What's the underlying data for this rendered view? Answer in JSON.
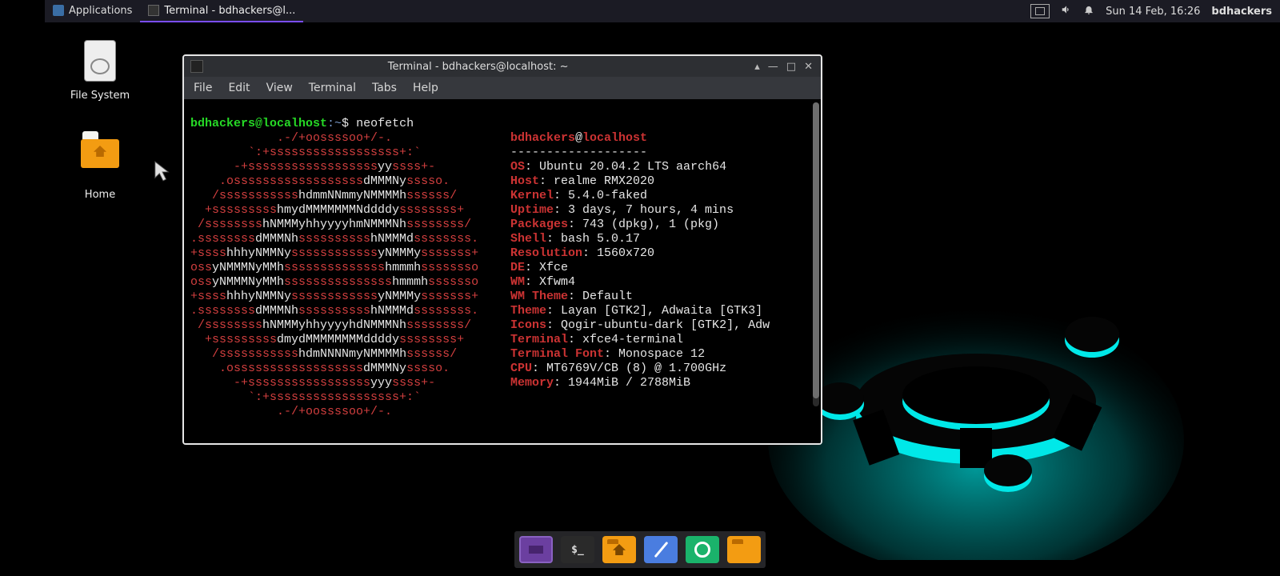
{
  "topbar": {
    "applications_label": "Applications",
    "task_title": "Terminal - bdhackers@l...",
    "clock": "Sun 14 Feb, 16:26",
    "user": "bdhackers"
  },
  "desktop": {
    "file_system_label": "File System",
    "home_label": "Home"
  },
  "window": {
    "title": "Terminal - bdhackers@localhost: ~",
    "menu": {
      "file": "File",
      "edit": "Edit",
      "view": "View",
      "terminal": "Terminal",
      "tabs": "Tabs",
      "help": "Help"
    }
  },
  "prompt": {
    "user_host": "bdhackers@localhost",
    "cwd": ":~",
    "sigil": "$",
    "command": "neofetch"
  },
  "neofetch": {
    "header_user": "bdhackers",
    "header_at": "@",
    "header_host": "localhost",
    "sep": "-------------------",
    "os_k": "OS",
    "os_v": "Ubuntu 20.04.2 LTS aarch64",
    "host_k": "Host",
    "host_v": "realme RMX2020",
    "kernel_k": "Kernel",
    "kernel_v": "5.4.0-faked",
    "uptime_k": "Uptime",
    "uptime_v": "3 days, 7 hours, 4 mins",
    "packages_k": "Packages",
    "packages_v": "743 (dpkg), 1 (pkg)",
    "shell_k": "Shell",
    "shell_v": "bash 5.0.17",
    "resolution_k": "Resolution",
    "resolution_v": "1560x720",
    "de_k": "DE",
    "de_v": "Xfce",
    "wm_k": "WM",
    "wm_v": "Xfwm4",
    "wmtheme_k": "WM Theme",
    "wmtheme_v": "Default",
    "theme_k": "Theme",
    "theme_v": "Layan [GTK2], Adwaita [GTK3]",
    "icons_k": "Icons",
    "icons_v": "Qogir-ubuntu-dark [GTK2], Adw",
    "terminal_k": "Terminal",
    "terminal_v": "xfce4-terminal",
    "termfont_k": "Terminal Font",
    "termfont_v": "Monospace 12",
    "cpu_k": "CPU",
    "cpu_v": "MT6769V/CB (8) @ 1.700GHz",
    "memory_k": "Memory",
    "memory_v": "1944MiB / 2788MiB"
  },
  "ascii": [
    "            .-/+oossssoo+/-.",
    "        `:+ssssssssssssssssss+:`",
    "      -+ssssssssssssssssssyyssss+-",
    "    .ossssssssssssssssssdMMMNysssso.",
    "   /ssssssssssshdmmNNmmyNMMMMhssssss/",
    "  +ssssssssshmydMMMMMMMNddddyssssssss+",
    " /sssssssshNMMMyhhyyyyhmNMMMNhssssssss/",
    ".ssssssssdMMMNhsssssssssshNMMMdssssssss.",
    "+sssshhhyNMMNyssssssssssssyNMMMysssssss+",
    "ossyNMMMNyMMhsssssssssssssshmmmhssssssso",
    "ossyNMMMNyMMhssssssssssssssshmmmhsssssso",
    "+sssshhhyNMMNyssssssssssssyNMMMysssssss+",
    ".ssssssssdMMMNhsssssssssshNMMMdssssssss.",
    " /sssssssshNMMMyhhyyyyhdNMMMNhssssssss/",
    "  +sssssssssdmydMMMMMMMMddddyssssssss+",
    "   /ssssssssssshdmNNNNmyNMMMMhssssss/",
    "    .ossssssssssssssssssdMMMNysssso.",
    "      -+sssssssssssssssssyyyssss+-",
    "        `:+ssssssssssssssssss+:`",
    "            .-/+oossssoo+/-."
  ],
  "palette": [
    "#3a3a3a",
    "#d22",
    "#2ecc40",
    "#d0cf00",
    "#2244dd",
    "#d63fd6",
    "#22cccc",
    "#888",
    "#e8e8e8"
  ],
  "dock": {
    "term_label": "$_"
  }
}
